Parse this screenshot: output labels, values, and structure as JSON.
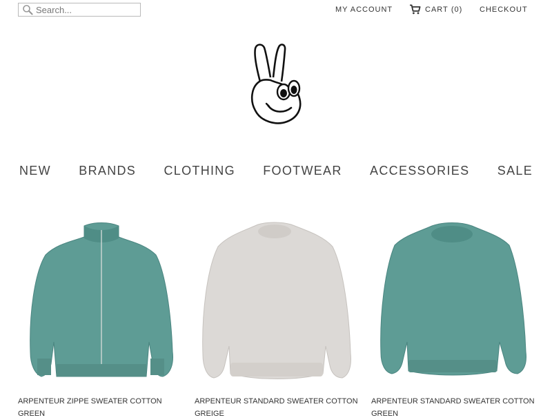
{
  "header": {
    "search": {
      "placeholder": "Search...",
      "value": ""
    },
    "my_account": "MY ACCOUNT",
    "cart": {
      "label": "CART",
      "count": "(0)"
    },
    "checkout": "CHECKOUT"
  },
  "nav": {
    "items": [
      "NEW",
      "BRANDS",
      "CLOTHING",
      "FOOTWEAR",
      "ACCESSORIES",
      "SALE"
    ]
  },
  "products": [
    {
      "title": "ARPENTEUR ZIPPE SWEATER COTTON GREEN",
      "image": "green-zip-sweater",
      "color": "#5e9c95"
    },
    {
      "title": "ARPENTEUR STANDARD SWEATER COTTON GREIGE",
      "image": "greige-crew-sweater",
      "color": "#dcd9d6"
    },
    {
      "title": "ARPENTEUR STANDARD SWEATER COTTON GREEN",
      "image": "green-crew-sweater",
      "color": "#5e9c95"
    }
  ],
  "logo": {
    "icon": "peace-hand-smiley-logo"
  }
}
